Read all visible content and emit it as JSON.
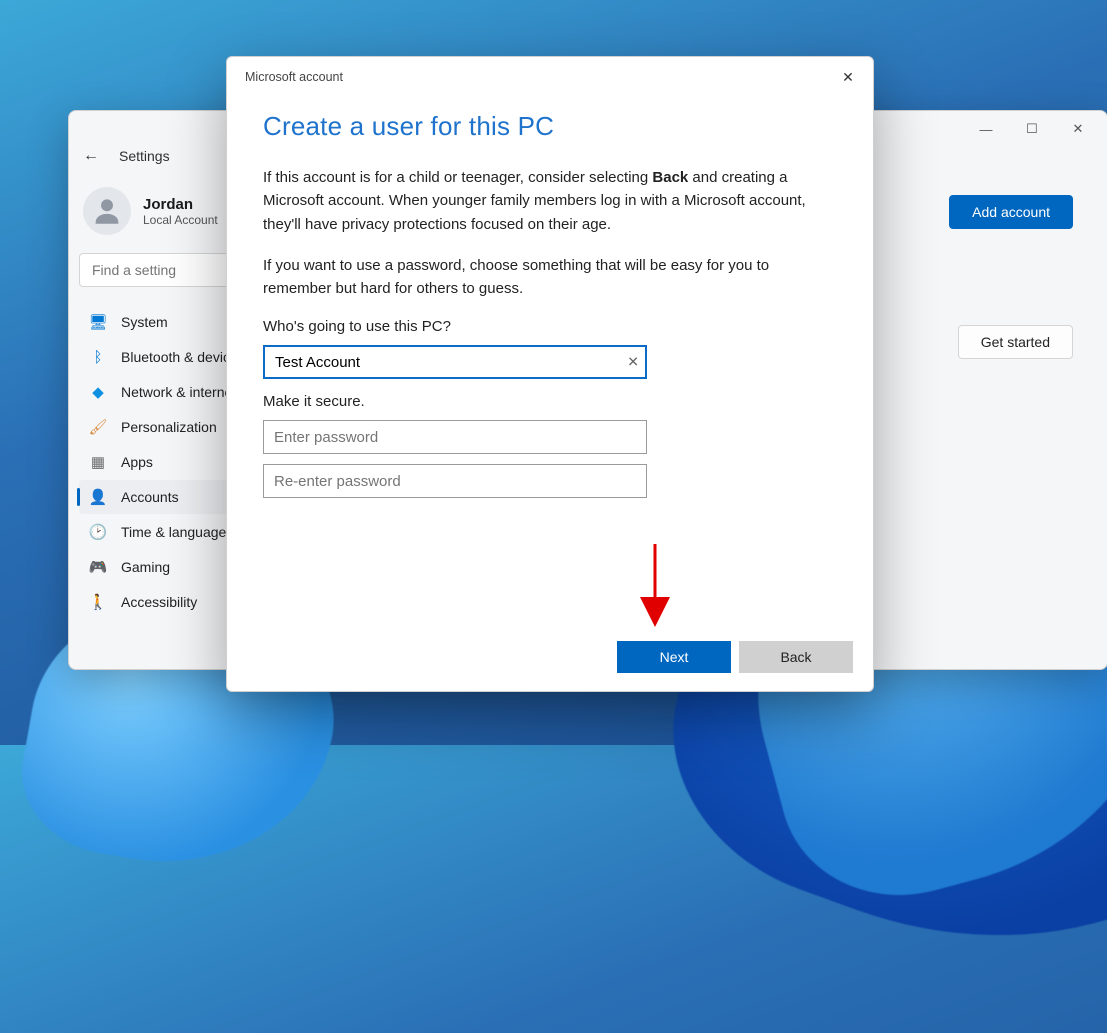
{
  "settings": {
    "titlebar": {
      "min": "—",
      "max": "☐",
      "close": "✕"
    },
    "header": {
      "title": "Settings"
    },
    "user": {
      "name": "Jordan",
      "sub": "Local Account"
    },
    "search": {
      "placeholder": "Find a setting"
    },
    "nav": {
      "items": [
        {
          "label": "System",
          "iconColor": "#0078d4",
          "glyph": "🖥"
        },
        {
          "label": "Bluetooth & devices",
          "iconColor": "#0078d4",
          "glyph": "ᛒ"
        },
        {
          "label": "Network & internet",
          "iconColor": "#0e90e0",
          "glyph": "◆"
        },
        {
          "label": "Personalization",
          "iconColor": "#d88b3f",
          "glyph": "🖌"
        },
        {
          "label": "Apps",
          "iconColor": "#6b6b6b",
          "glyph": "▦"
        },
        {
          "label": "Accounts",
          "iconColor": "#3caa55",
          "glyph": "👤"
        },
        {
          "label": "Time & language",
          "iconColor": "#4a90c5",
          "glyph": "🕑"
        },
        {
          "label": "Gaming",
          "iconColor": "#6c6c6c",
          "glyph": "🎮"
        },
        {
          "label": "Accessibility",
          "iconColor": "#0a6cc6",
          "glyph": "🚶"
        }
      ],
      "activeIndex": 5
    },
    "main": {
      "add_account": "Add account",
      "get_started": "Get started"
    }
  },
  "modal": {
    "title": "Microsoft account",
    "heading": "Create a user for this PC",
    "para1_pre": "If this account is for a child or teenager, consider selecting ",
    "para1_bold": "Back",
    "para1_post": " and creating a Microsoft account. When younger family members log in with a Microsoft account, they'll have privacy protections focused on their age.",
    "para2": "If you want to use a password, choose something that will be easy for you to remember but hard for others to guess.",
    "who_label": "Who's going to use this PC?",
    "username_value": "Test Account",
    "secure_label": "Make it secure.",
    "pwd_placeholder": "Enter password",
    "pwd2_placeholder": "Re-enter password",
    "next": "Next",
    "back": "Back"
  }
}
